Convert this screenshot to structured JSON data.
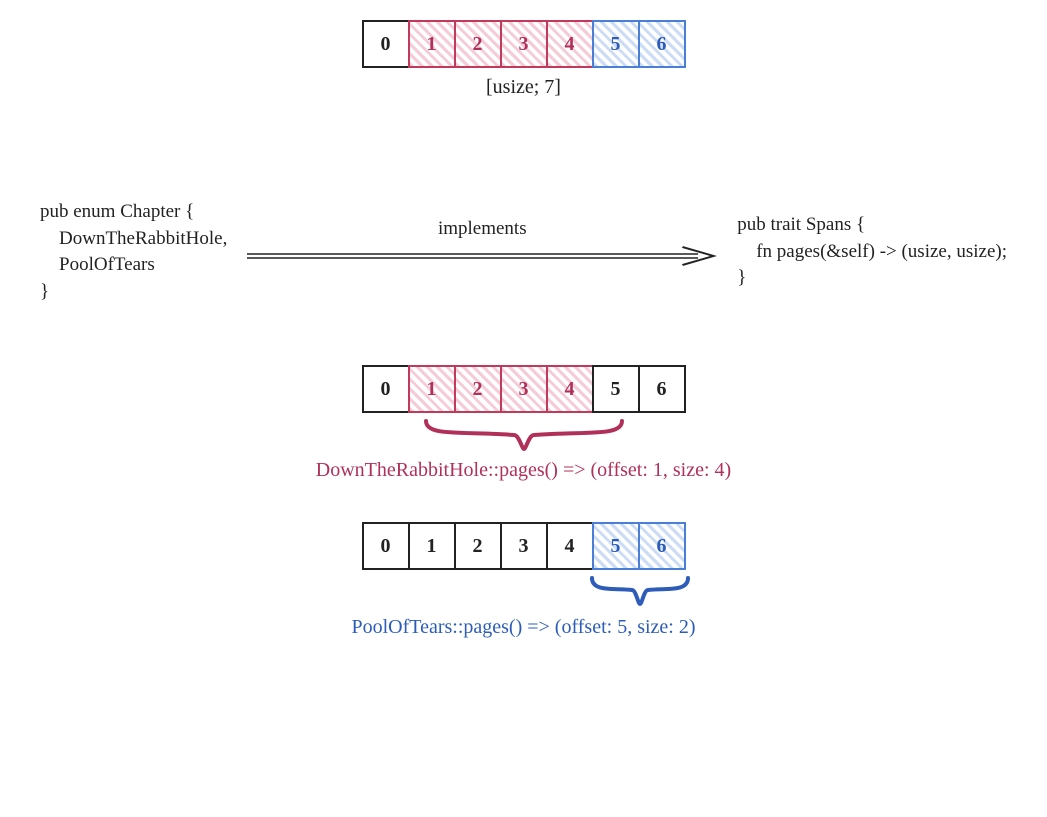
{
  "array_type_label": "[usize; 7]",
  "cells": [
    "0",
    "1",
    "2",
    "3",
    "4",
    "5",
    "6"
  ],
  "enum_code": "pub enum Chapter {\n    DownTheRabbitHole,\n    PoolOfTears\n}",
  "trait_code": "pub trait Spans {\n    fn pages(&self) -> (usize, usize);\n}",
  "implements_label": "implements",
  "rabbit_caption": "DownTheRabbitHole::pages() => (offset: 1, size: 4)",
  "pool_caption": "PoolOfTears::pages() => (offset: 5, size: 2)",
  "spans": {
    "rabbit": {
      "offset": 1,
      "size": 4,
      "color": "red"
    },
    "pool": {
      "offset": 5,
      "size": 2,
      "color": "blue"
    }
  }
}
